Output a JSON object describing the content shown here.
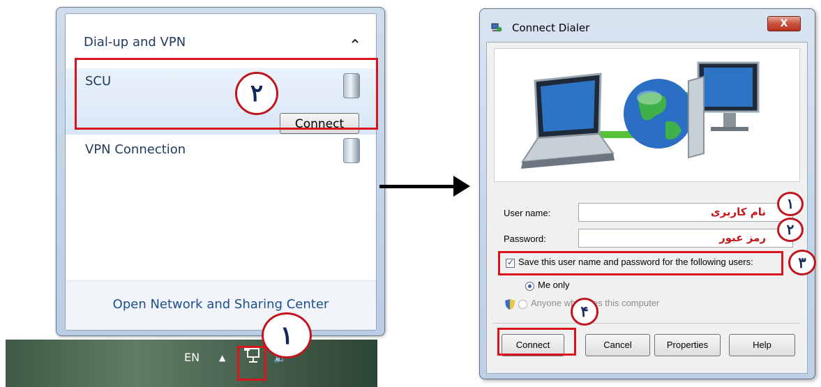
{
  "network_flyout": {
    "section_title": "Dial-up and VPN",
    "connections": [
      {
        "label": "SCU",
        "button_label": "Connect"
      },
      {
        "label": "VPN Connection"
      }
    ],
    "footer_link": "Open Network and Sharing Center"
  },
  "taskbar": {
    "language": "EN"
  },
  "dialer": {
    "title": "Connect Dialer",
    "close_symbol": "X",
    "username_label": "User name:",
    "username_value": "نام کاربری",
    "password_label": "Password:",
    "password_value": "رمز عبور",
    "save_checkbox_label": "Save this user name and password for the following users:",
    "save_checked": true,
    "radio_me_only": "Me only",
    "radio_anyone": "Anyone who uses this computer",
    "buttons": {
      "connect": "Connect",
      "cancel": "Cancel",
      "properties": "Properties",
      "help": "Help"
    }
  },
  "annotations": {
    "badge_1": "۱",
    "badge_2": "۲",
    "badge_3": "۳",
    "badge_4": "۴"
  },
  "colors": {
    "highlight": "#d8141c",
    "badge_text": "#12265a",
    "link": "#1e4e8c"
  }
}
